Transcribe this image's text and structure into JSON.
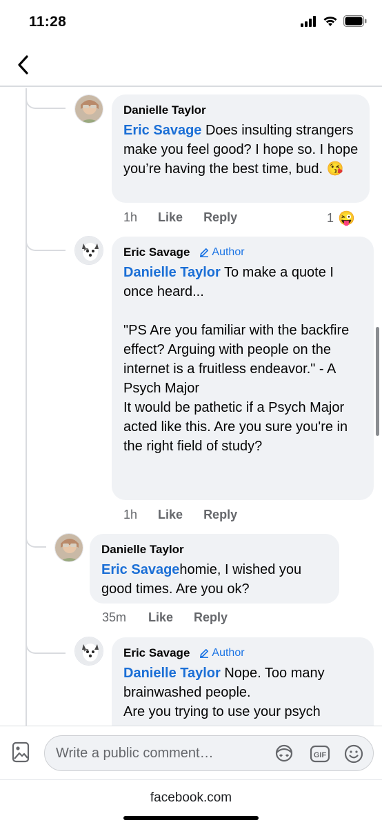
{
  "status_bar": {
    "time": "11:28"
  },
  "thread": {
    "comments": [
      {
        "author": "Danielle Taylor",
        "mention": "Eric Savage",
        "text": " Does insulting strangers make you feel good? I hope so. I hope you’re having the best time, bud. 😘",
        "time": "1h",
        "like_label": "Like",
        "reply_label": "Reply",
        "reaction_count": "1",
        "reaction_emoji": "😜"
      },
      {
        "author": "Eric Savage",
        "badge": "Author",
        "mention": "Danielle Taylor",
        "text": " To make a quote I once heard...\n\n\"PS Are you familiar with the backfire effect? Arguing with people on the internet is a fruitless endeavor.\" - A Psych Major\nIt would be pathetic if a Psych Major acted like this. Are you sure you're in the right field of study?",
        "time": "1h",
        "like_label": "Like",
        "reply_label": "Reply"
      },
      {
        "author": "Danielle Taylor",
        "mention": "Eric Savage",
        "text": "homie, I wished you good times. Are you ok?",
        "time": "35m",
        "like_label": "Like",
        "reply_label": "Reply"
      },
      {
        "author": "Eric Savage",
        "badge": "Author",
        "mention": "Danielle Taylor",
        "text": " Nope. Too many brainwashed people.\nAre you trying to use your psych"
      }
    ]
  },
  "composer": {
    "placeholder": "Write a public comment…",
    "icons": [
      "photo-icon",
      "avatar-sticker-icon",
      "gif-icon",
      "emoji-icon"
    ]
  },
  "browser": {
    "url": "facebook.com"
  },
  "colors": {
    "mention": "#1b6fd6",
    "bubble": "#f0f2f5",
    "meta": "#65676b",
    "author_badge": "#1b74e4"
  }
}
